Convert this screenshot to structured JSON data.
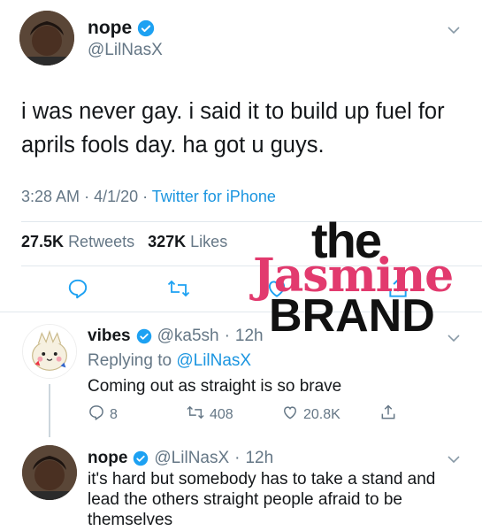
{
  "main_tweet": {
    "display_name": "nope",
    "handle": "@LilNasX",
    "text": "i was never gay. i said it to build up fuel for aprils fools day. ha got u guys.",
    "time": "3:28 AM",
    "date": "4/1/20",
    "client": "Twitter for iPhone",
    "retweets_count": "27.5K",
    "retweets_label": "Retweets",
    "likes_count": "327K",
    "likes_label": "Likes"
  },
  "replies": [
    {
      "display_name": "vibes",
      "handle": "@ka5sh",
      "age": "12h",
      "replying_to_label": "Replying to",
      "replying_to_handle": "@LilNasX",
      "text": "Coming out as straight is so brave",
      "reply_count": "8",
      "retweet_count": "408",
      "like_count": "20.8K"
    },
    {
      "display_name": "nope",
      "handle": "@LilNasX",
      "age": "12h",
      "text": "it's hard but somebody has to take a stand and lead the others straight people afraid to be themselves"
    }
  ],
  "watermark": {
    "line1": "the",
    "line2": "Jasmine",
    "line3": "BRAND"
  },
  "icons": {
    "verified": "verified-badge-icon",
    "more": "chevron-down-icon",
    "reply": "reply-icon",
    "retweet": "retweet-icon",
    "like": "heart-icon",
    "share": "share-icon"
  },
  "colors": {
    "accent": "#1da1f2",
    "link": "#1b95e0",
    "secondary_text": "#657786",
    "watermark_pink": "#e23a6e"
  }
}
